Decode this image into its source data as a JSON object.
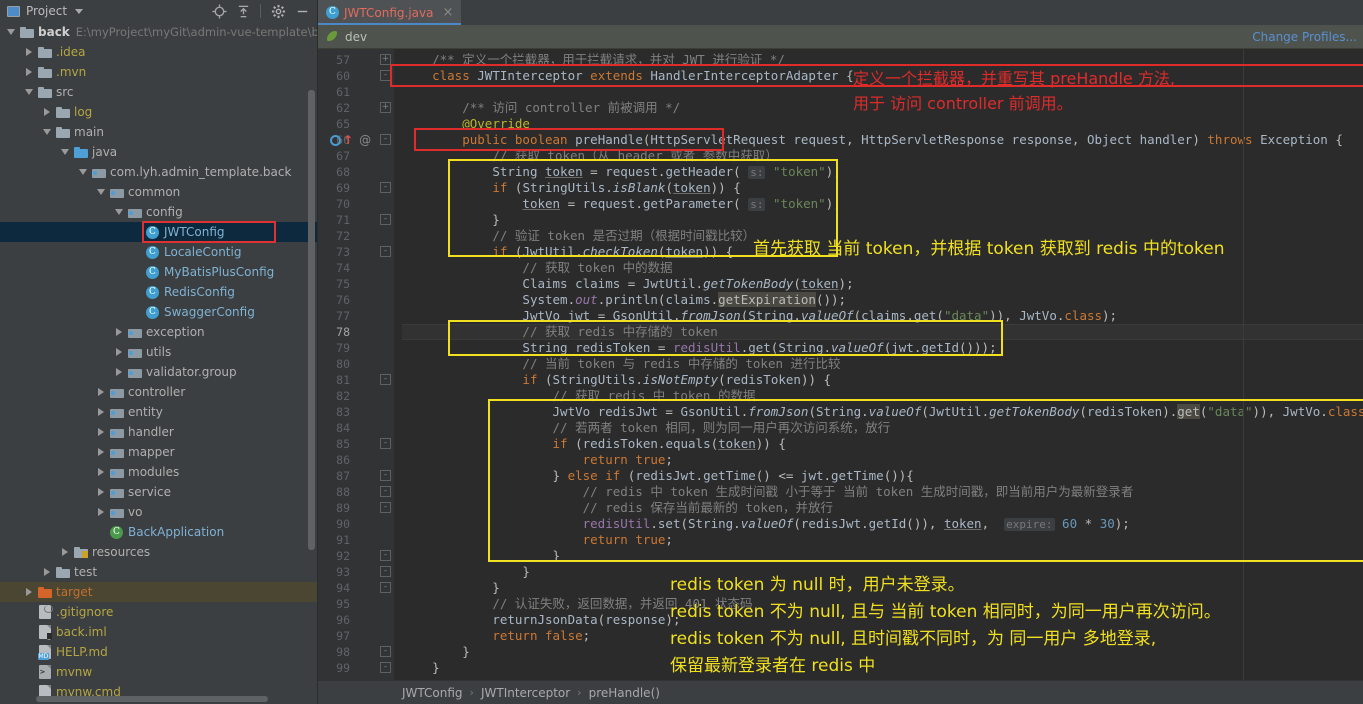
{
  "left_panel": {
    "toolbar": {
      "title": "Project",
      "icons": [
        "locate-icon",
        "collapse-all-icon",
        "gear-icon",
        "minimize-icon"
      ],
      "dropdown": "chevron-down-icon"
    },
    "tree": [
      {
        "indent": 0,
        "arrow": "down",
        "icon": "folder-module",
        "label": "back",
        "sub": "E:\\myProject\\myGit\\admin-vue-template\\b",
        "color": "white",
        "bold": true
      },
      {
        "indent": 1,
        "arrow": "right",
        "icon": "folder",
        "label": ".idea",
        "color": "yellow"
      },
      {
        "indent": 1,
        "arrow": "right",
        "icon": "folder",
        "label": ".mvn",
        "color": "yellow"
      },
      {
        "indent": 1,
        "arrow": "down",
        "icon": "folder",
        "label": "src",
        "color": "grey"
      },
      {
        "indent": 2,
        "arrow": "right",
        "icon": "folder",
        "label": "log",
        "color": "yellow"
      },
      {
        "indent": 2,
        "arrow": "down",
        "icon": "folder",
        "label": "main",
        "color": "grey"
      },
      {
        "indent": 3,
        "arrow": "down",
        "icon": "folder-source",
        "label": "java",
        "color": "grey"
      },
      {
        "indent": 4,
        "arrow": "down",
        "icon": "package",
        "label": "com.lyh.admin_template.back",
        "color": "grey"
      },
      {
        "indent": 5,
        "arrow": "down",
        "icon": "package",
        "label": "common",
        "color": "grey"
      },
      {
        "indent": 6,
        "arrow": "down",
        "icon": "package",
        "label": "config",
        "color": "grey"
      },
      {
        "indent": 7,
        "arrow": "none",
        "icon": "class",
        "label": "JWTConfig",
        "color": "class",
        "selected": true,
        "highlight_box": true
      },
      {
        "indent": 7,
        "arrow": "none",
        "icon": "class",
        "label": "LocaleContig",
        "color": "class"
      },
      {
        "indent": 7,
        "arrow": "none",
        "icon": "class",
        "label": "MyBatisPlusConfig",
        "color": "class"
      },
      {
        "indent": 7,
        "arrow": "none",
        "icon": "class",
        "label": "RedisConfig",
        "color": "class"
      },
      {
        "indent": 7,
        "arrow": "none",
        "icon": "class",
        "label": "SwaggerConfig",
        "color": "class"
      },
      {
        "indent": 6,
        "arrow": "right",
        "icon": "package",
        "label": "exception",
        "color": "grey"
      },
      {
        "indent": 6,
        "arrow": "right",
        "icon": "package",
        "label": "utils",
        "color": "grey"
      },
      {
        "indent": 6,
        "arrow": "right",
        "icon": "package",
        "label": "validator.group",
        "color": "grey"
      },
      {
        "indent": 5,
        "arrow": "right",
        "icon": "package",
        "label": "controller",
        "color": "grey"
      },
      {
        "indent": 5,
        "arrow": "right",
        "icon": "package",
        "label": "entity",
        "color": "grey"
      },
      {
        "indent": 5,
        "arrow": "right",
        "icon": "package",
        "label": "handler",
        "color": "grey"
      },
      {
        "indent": 5,
        "arrow": "right",
        "icon": "package",
        "label": "mapper",
        "color": "grey"
      },
      {
        "indent": 5,
        "arrow": "right",
        "icon": "package",
        "label": "modules",
        "color": "grey"
      },
      {
        "indent": 5,
        "arrow": "right",
        "icon": "package",
        "label": "service",
        "color": "grey"
      },
      {
        "indent": 5,
        "arrow": "right",
        "icon": "package",
        "label": "vo",
        "color": "grey"
      },
      {
        "indent": 5,
        "arrow": "none",
        "icon": "class-run",
        "label": "BackApplication",
        "color": "class"
      },
      {
        "indent": 3,
        "arrow": "right",
        "icon": "folder-res",
        "label": "resources",
        "color": "grey"
      },
      {
        "indent": 2,
        "arrow": "right",
        "icon": "folder",
        "label": "test",
        "color": "grey"
      },
      {
        "indent": 1,
        "arrow": "right",
        "icon": "folder-target",
        "label": "target",
        "color": "orange",
        "target_row": true
      },
      {
        "indent": 1,
        "arrow": "none",
        "icon": "file-git",
        "label": ".gitignore",
        "color": "yellow"
      },
      {
        "indent": 1,
        "arrow": "none",
        "icon": "file-iml",
        "label": "back.iml",
        "color": "yellow"
      },
      {
        "indent": 1,
        "arrow": "none",
        "icon": "file-md",
        "label": "HELP.md",
        "color": "yellow"
      },
      {
        "indent": 1,
        "arrow": "none",
        "icon": "file-sh",
        "label": "mvnw",
        "color": "yellow"
      },
      {
        "indent": 1,
        "arrow": "none",
        "icon": "file-cmd",
        "label": "mvnw.cmd",
        "color": "yellow"
      }
    ]
  },
  "editor": {
    "tab": {
      "label": "JWTConfig.java",
      "icon": "java-class-icon",
      "close": "×"
    },
    "profile_bar": {
      "icon": "spring-leaf-icon",
      "name": "dev",
      "change_link": "Change Profiles..."
    },
    "breadcrumb": [
      "JWTConfig",
      "JWTInterceptor",
      "preHandle()"
    ],
    "breadcrumb_sep": "›",
    "first_line_number": 57,
    "current_line": 78,
    "lines": [
      {
        "n": 57,
        "fold": "+",
        "html": "    <span class=\"cm\">/** 定义一个拦截器，用于拦截请求，并对 JWT 进行验证 */</span>"
      },
      {
        "n": 60,
        "fold": "-",
        "html": "    <span class=\"k\">class</span> <span class=\"id\">JWTInterceptor</span> <span class=\"k\">extends</span> <span class=\"id\">HandlerInterceptorAdapter</span> {"
      },
      {
        "n": 61,
        "fold": "",
        "html": ""
      },
      {
        "n": 62,
        "fold": "+",
        "html": "        <span class=\"cm\">/** 访问 controller 前被调用 */</span>"
      },
      {
        "n": 65,
        "fold": "",
        "html": "        <span class=\"ann\">@Override</span>"
      },
      {
        "n": 66,
        "fold": "-",
        "html": "        <span class=\"k\">public</span> <span class=\"k\">boolean</span> <span class=\"id\">preHandle</span>(<span class=\"id\">HttpServletRequest</span> <span class=\"id\">request</span>, <span class=\"id\">HttpServletResponse</span> <span class=\"id\">response</span>, <span class=\"id\">Object</span> <span class=\"id\">handler</span>) <span class=\"k\">throws</span> <span class=\"id\">Exception</span> {"
      },
      {
        "n": 67,
        "fold": "",
        "html": "            <span class=\"cm\">// 获取 token（从 header 或者 参数中获取）</span>"
      },
      {
        "n": 68,
        "fold": "",
        "html": "            <span class=\"id\">String</span> <span class=\"ul id\">token</span> = <span class=\"id\">request</span>.<span class=\"id\">getHeader</span>( <span class=\"par\">s:</span> <span class=\"s\">\"token\"</span>);"
      },
      {
        "n": 69,
        "fold": "-",
        "html": "            <span class=\"k\">if</span> (<span class=\"id\">StringUtils</span>.<span class=\"it\">isBlank</span>(<span class=\"ul id\">token</span>)) {"
      },
      {
        "n": 70,
        "fold": "",
        "html": "                <span class=\"ul id\">token</span> = <span class=\"id\">request</span>.<span class=\"id\">getParameter</span>( <span class=\"par\">s:</span> <span class=\"s\">\"token\"</span>);"
      },
      {
        "n": 71,
        "fold": "-",
        "html": "            }"
      },
      {
        "n": 72,
        "fold": "",
        "html": "            <span class=\"cm\">// 验证 token 是否过期（根据时间戳比较）</span>"
      },
      {
        "n": 73,
        "fold": "-",
        "html": "            <span class=\"k\">if</span> (<span class=\"id\">JwtUtil</span>.<span class=\"it\">checkToken</span>(<span class=\"ul id\">token</span>)) {"
      },
      {
        "n": 74,
        "fold": "",
        "html": "                <span class=\"cm\">// 获取 token 中的数据</span>"
      },
      {
        "n": 75,
        "fold": "",
        "html": "                <span class=\"id\">Claims</span> <span class=\"id\">claims</span> = <span class=\"id\">JwtUtil</span>.<span class=\"it\">getTokenBody</span>(<span class=\"ul id\">token</span>);"
      },
      {
        "n": 76,
        "fold": "",
        "html": "                <span class=\"id\">System</span>.<span class=\"it fld\">out</span>.<span class=\"id\">println</span>(<span class=\"id\">claims</span>.<span class=\"hlgrey\">getExpiration</span>());"
      },
      {
        "n": 77,
        "fold": "",
        "html": "                <span class=\"id\">JwtVo</span> <span class=\"id\">jwt</span> = <span class=\"id\">GsonUtil</span>.<span class=\"it\">fromJson</span>(<span class=\"id\">String</span>.<span class=\"it\">valueOf</span>(<span class=\"id\">claims</span>.<span class=\"id\">get</span>(<span class=\"s\">\"data\"</span>)), <span class=\"id\">JwtVo</span>.<span class=\"k\">class</span>);"
      },
      {
        "n": 78,
        "fold": "",
        "html": "                <span class=\"cm\">// 获取 redis 中存储的 token</span>"
      },
      {
        "n": 79,
        "fold": "",
        "html": "                <span class=\"id\">String</span> <span class=\"id\">redisToken</span> = <span class=\"fld\">redisUtil</span>.<span class=\"id\">get</span>(<span class=\"id\">String</span>.<span class=\"it\">valueOf</span>(<span class=\"id\">jwt</span>.<span class=\"id\">getId</span>()));"
      },
      {
        "n": 80,
        "fold": "",
        "html": "                <span class=\"cm\">// 当前 token 与 redis 中存储的 token 进行比较</span>"
      },
      {
        "n": 81,
        "fold": "-",
        "html": "                <span class=\"k\">if</span> (<span class=\"id\">StringUtils</span>.<span class=\"it\">isNotEmpty</span>(<span class=\"id\">redisToken</span>)) {"
      },
      {
        "n": 82,
        "fold": "",
        "html": "                    <span class=\"cm\">// 获取 redis 中 token 的数据</span>"
      },
      {
        "n": 83,
        "fold": "",
        "html": "                    <span class=\"id\">JwtVo</span> <span class=\"id\">redisJwt</span> = <span class=\"id\">GsonUtil</span>.<span class=\"it\">fromJson</span>(<span class=\"id\">String</span>.<span class=\"it\">valueOf</span>(<span class=\"id\">JwtUtil</span>.<span class=\"it\">getTokenBody</span>(<span class=\"id\">redisToken</span>).<span class=\"hlgrey\">get</span>(<span class=\"s\">\"data\"</span>)), <span class=\"id\">JwtVo</span>.<span class=\"k\">class</span>);"
      },
      {
        "n": 84,
        "fold": "",
        "html": "                    <span class=\"cm\">// 若两者 token 相同，则为同一用户再次访问系统，放行</span>"
      },
      {
        "n": 85,
        "fold": "-",
        "html": "                    <span class=\"k\">if</span> (<span class=\"id\">redisToken</span>.<span class=\"id\">equals</span>(<span class=\"ul id\">token</span>)) {"
      },
      {
        "n": 86,
        "fold": "",
        "html": "                        <span class=\"k\">return</span> <span class=\"k\">true</span>;"
      },
      {
        "n": 87,
        "fold": "-",
        "html": "                    } <span class=\"k\">else if</span> (<span class=\"id\">redisJwt</span>.<span class=\"id\">getTime</span>() &lt;= <span class=\"id\">jwt</span>.<span class=\"id\">getTime</span>()){"
      },
      {
        "n": 88,
        "fold": "-",
        "html": "                        <span class=\"cm\">// redis 中 token 生成时间戳 小于等于 当前 token 生成时间戳，即当前用户为最新登录者</span>"
      },
      {
        "n": 89,
        "fold": "-",
        "html": "                        <span class=\"cm\">// redis 保存当前最新的 token，并放行</span>"
      },
      {
        "n": 90,
        "fold": "",
        "html": "                        <span class=\"fld\">redisUtil</span>.<span class=\"id\">set</span>(<span class=\"id\">String</span>.<span class=\"it\">valueOf</span>(<span class=\"id\">redisJwt</span>.<span class=\"id\">getId</span>()), <span class=\"ul id\">token</span>,  <span class=\"par\">expire:</span> <span class=\"num\">60</span> * <span class=\"num\">30</span>);"
      },
      {
        "n": 91,
        "fold": "",
        "html": "                        <span class=\"k\">return</span> <span class=\"k\">true</span>;"
      },
      {
        "n": 92,
        "fold": "-",
        "html": "                    }"
      },
      {
        "n": 93,
        "fold": "-",
        "html": "                }"
      },
      {
        "n": 94,
        "fold": "-",
        "html": "            }"
      },
      {
        "n": 95,
        "fold": "",
        "html": "            <span class=\"cm\">// 认证失败，返回数据，并返回 401 状态码</span>"
      },
      {
        "n": 96,
        "fold": "",
        "html": "            <span class=\"id\">returnJsonData</span>(<span class=\"id\">response</span>);"
      },
      {
        "n": 97,
        "fold": "",
        "html": "            <span class=\"k\">return</span> <span class=\"k\">false</span>;"
      },
      {
        "n": 98,
        "fold": "-",
        "html": "        }"
      },
      {
        "n": 99,
        "fold": "-",
        "html": "    }"
      }
    ],
    "gutter_markers": [
      {
        "line": 66,
        "icons": [
          "override-method-icon",
          "implement-arrow-icon",
          "annotation-icon"
        ]
      }
    ],
    "annotations": [
      {
        "id": "anno-red-1",
        "color": "#e02b2b",
        "lines": [
          "定义一个拦截器，并重写其 preHandle 方法,",
          "用于 访问 controller 前调用。"
        ]
      },
      {
        "id": "anno-yellow-1",
        "color": "#f0e020",
        "lines": [
          "首先获取 当前 token，并根据 token 获取到 redis 中的token"
        ]
      },
      {
        "id": "anno-yellow-2",
        "color": "#f0e020",
        "lines": [
          "redis token 为 null 时，用户未登录。",
          "redis token 不为 null, 且与 当前 token 相同时，为同一用户再次访问。",
          "redis token 不为 null, 且时间戳不同时，为 同一用户 多地登录,",
          "保留最新登录者在 redis 中"
        ]
      }
    ],
    "highlight_boxes": [
      {
        "name": "class-decl-box",
        "color": "#e02b2b"
      },
      {
        "name": "prehandle-sig-box",
        "color": "#e02b2b"
      },
      {
        "name": "get-token-box",
        "color": "#f0e020"
      },
      {
        "name": "redis-token-box",
        "color": "#f0e020"
      },
      {
        "name": "compare-token-box",
        "color": "#f0e020"
      }
    ]
  }
}
